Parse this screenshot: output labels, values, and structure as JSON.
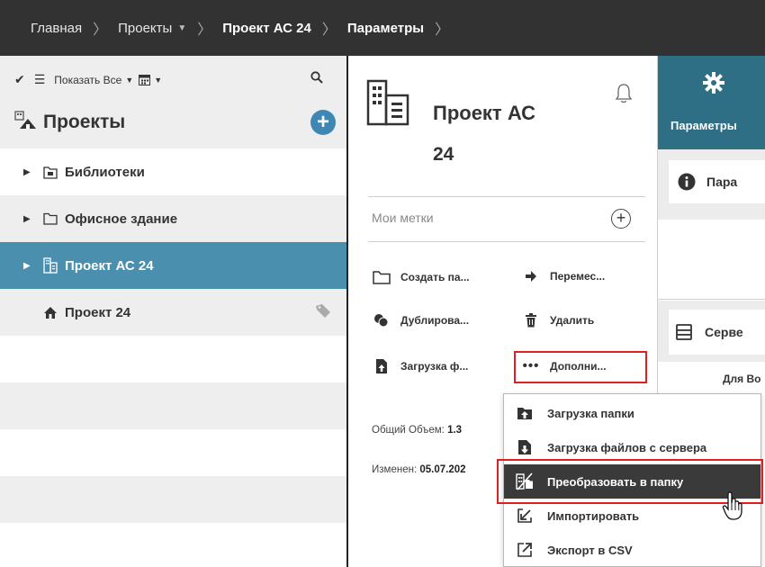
{
  "breadcrumb": {
    "items": [
      "Главная",
      "Проекты",
      "Проект АС 24",
      "Параметры"
    ]
  },
  "left_panel": {
    "toolbar": {
      "show_all": "Показать Все"
    },
    "header": "Проекты",
    "tree": [
      {
        "label": "Библиотеки",
        "icon": "library-icon",
        "selected": false
      },
      {
        "label": "Офисное здание",
        "icon": "folder-icon",
        "selected": false
      },
      {
        "label": "Проект АС 24",
        "icon": "building-icon",
        "selected": true
      },
      {
        "label": "Проект 24",
        "icon": "home-icon",
        "selected": false
      }
    ],
    "accent": "#4a8fae"
  },
  "project": {
    "title": "Проект АС",
    "title_line2": "24",
    "tags_label": "Мои метки",
    "actions": {
      "create": "Создать па...",
      "move": "Перемес...",
      "duplicate": "Дублирова...",
      "delete": "Удалить",
      "upload": "Загрузка ф...",
      "more": "Дополни..."
    },
    "info": {
      "total_label": "Общий Объем:",
      "total_value": "1.3",
      "modified_label": "Изменен:",
      "modified_value": "05.07.202"
    }
  },
  "right_panel": {
    "tab_label": "Параметры",
    "card1": "Пара",
    "card2": "Серве",
    "note": "Для Во",
    "accent": "#2f6f86"
  },
  "menu": {
    "items": [
      {
        "label": "Загрузка папки",
        "icon": "upload-folder-icon",
        "highlighted": false
      },
      {
        "label": "Загрузка файлов с сервера",
        "icon": "server-download-icon",
        "highlighted": false
      },
      {
        "label": "Преобразовать в папку",
        "icon": "convert-icon",
        "highlighted": true
      },
      {
        "label": "Импортировать",
        "icon": "import-icon",
        "highlighted": false
      },
      {
        "label": "Экспорт в CSV",
        "icon": "export-icon",
        "highlighted": false
      }
    ]
  }
}
